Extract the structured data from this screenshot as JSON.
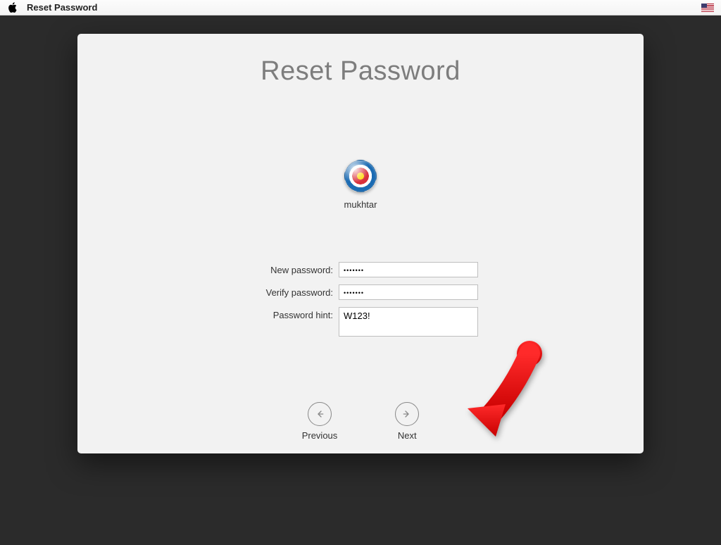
{
  "menubar": {
    "title": "Reset Password"
  },
  "window": {
    "title": "Reset Password",
    "user": {
      "name": "mukhtar"
    },
    "form": {
      "new_password_label": "New password:",
      "new_password_value": "•••••••",
      "verify_password_label": "Verify password:",
      "verify_password_value": "•••••••",
      "hint_label": "Password hint:",
      "hint_value": "W123!"
    },
    "nav": {
      "previous": "Previous",
      "next": "Next"
    }
  }
}
